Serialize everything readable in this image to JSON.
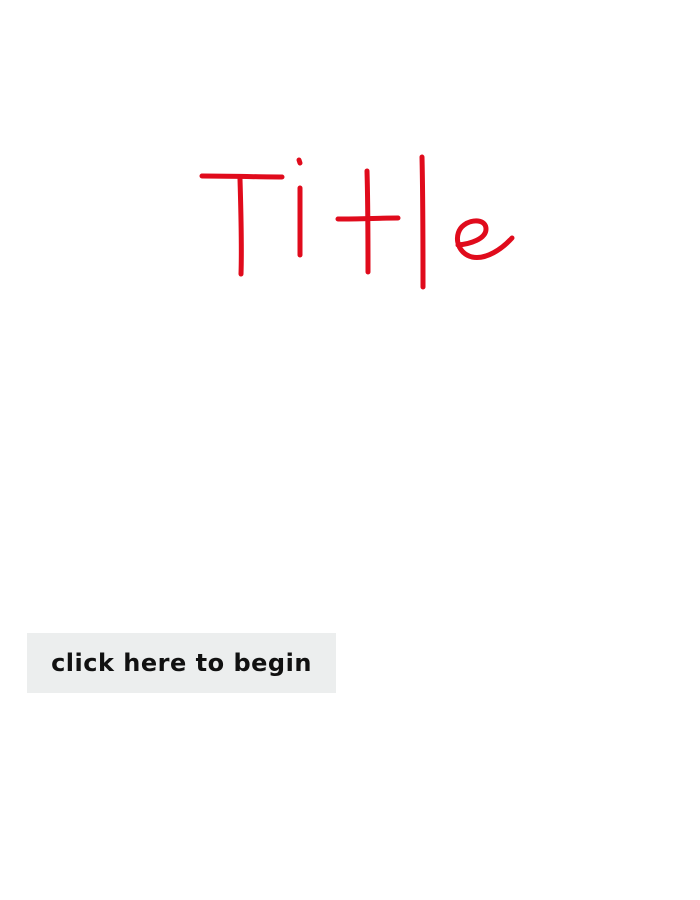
{
  "title": {
    "text": "Title",
    "color": "#e00b1c"
  },
  "start": {
    "label": "click here to begin",
    "background": "#eceeee",
    "text_color": "#111111"
  }
}
